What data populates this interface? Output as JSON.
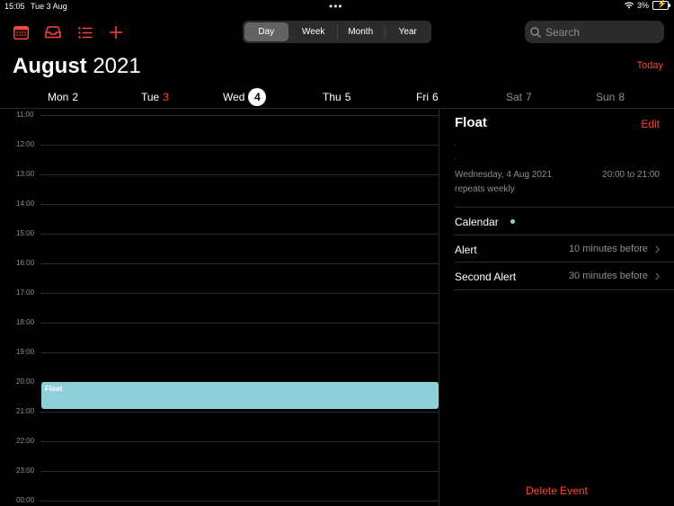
{
  "status_bar": {
    "time": "15:05",
    "date": "Tue 3 Aug",
    "more": "•••",
    "battery": "3%"
  },
  "toolbar": {
    "segments": [
      "Day",
      "Week",
      "Month",
      "Year"
    ],
    "active_segment": "Day",
    "search_placeholder": "Search"
  },
  "header": {
    "month": "August",
    "year": "2021",
    "today_label": "Today"
  },
  "days": [
    {
      "name": "Mon",
      "num": "2"
    },
    {
      "name": "Tue",
      "num": "3"
    },
    {
      "name": "Wed",
      "num": "4"
    },
    {
      "name": "Thu",
      "num": "5"
    },
    {
      "name": "Fri",
      "num": "6"
    },
    {
      "name": "Sat",
      "num": "7"
    },
    {
      "name": "Sun",
      "num": "8"
    }
  ],
  "hours": [
    "11:00",
    "12:00",
    "13:00",
    "14:00",
    "15:00",
    "16:00",
    "17:00",
    "18:00",
    "19:00",
    "20:00",
    "21:00",
    "22:00",
    "23:00",
    "00:00"
  ],
  "event": {
    "title": "Float"
  },
  "detail": {
    "title": "Float",
    "edit_label": "Edit",
    "dot1": ".",
    "dot2": ".",
    "date": "Wednesday, 4 Aug 2021",
    "time": "20:00 to 21:00",
    "repeat": "repeats weekly",
    "calendar_label": "Calendar",
    "alert_label": "Alert",
    "alert_value": "10 minutes before",
    "second_alert_label": "Second Alert",
    "second_alert_value": "30 minutes before",
    "delete_label": "Delete Event"
  },
  "colors": {
    "accent": "#ff453a",
    "event": "#8fd0d8",
    "background": "#000000"
  }
}
